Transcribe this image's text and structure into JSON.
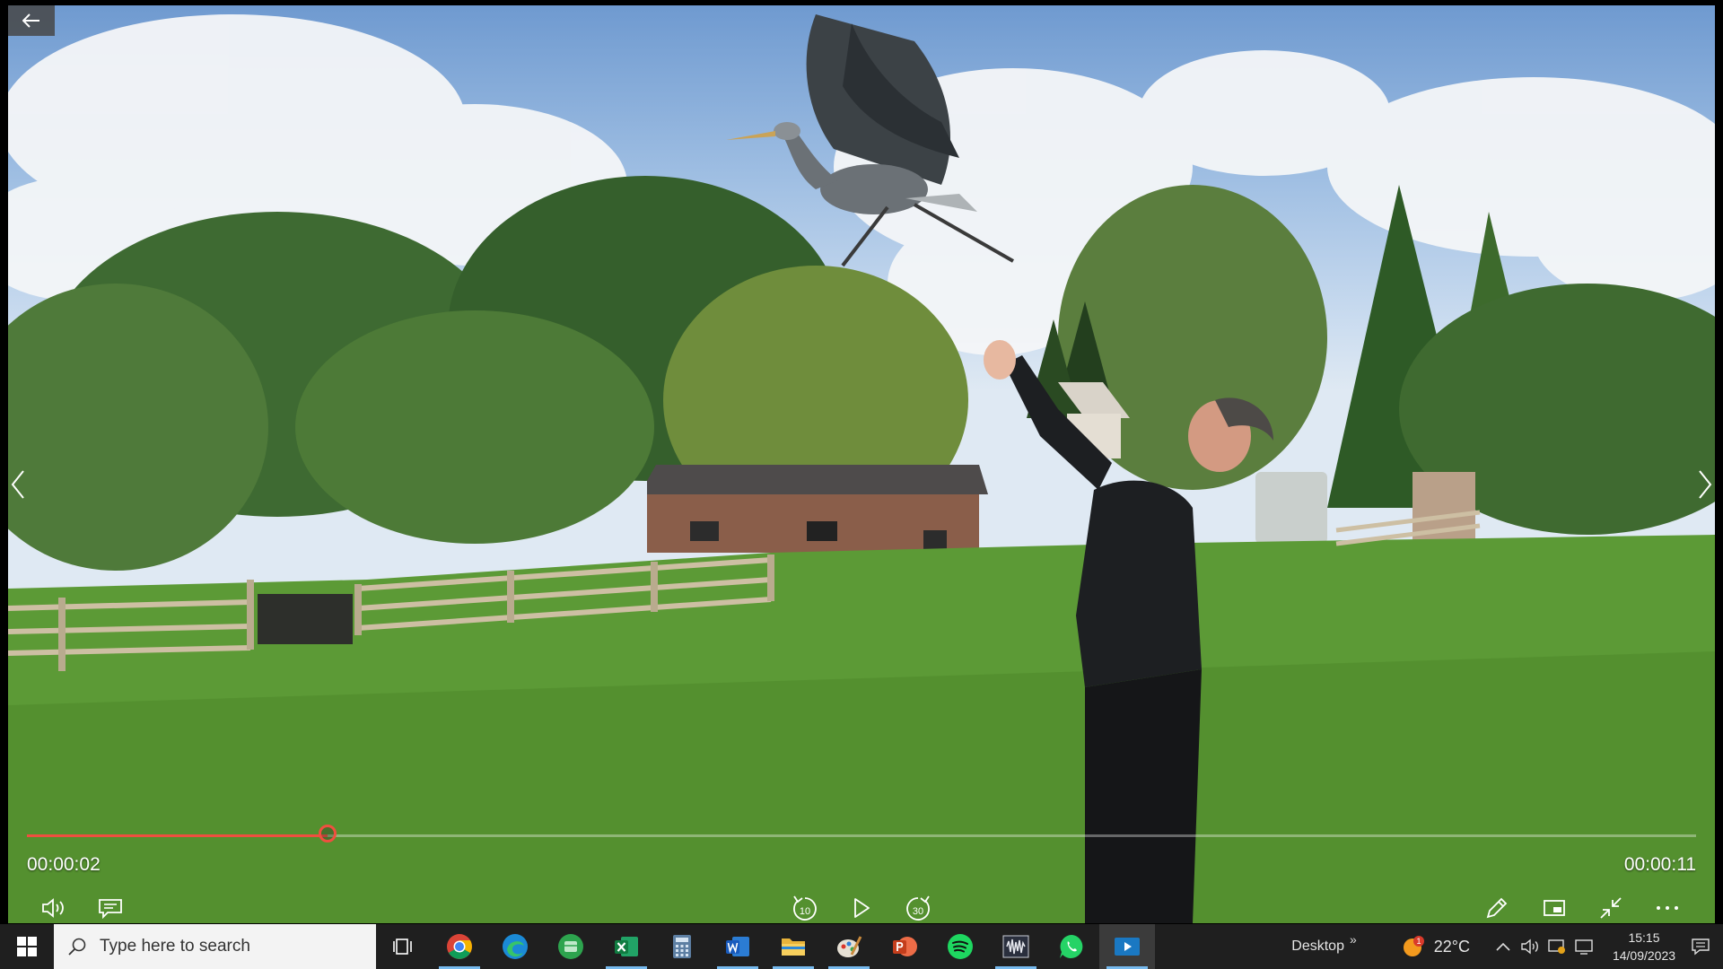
{
  "player": {
    "current_time": "00:00:02",
    "total_time": "00:00:11",
    "progress": 0.18,
    "accent_color": "#ef4f3f",
    "controls": {
      "volume": "volume-icon",
      "captions": "captions-icon",
      "skip_back_label": "10",
      "play": "play-icon",
      "skip_forward_label": "30",
      "edit": "pencil-icon",
      "mini_view": "mini-view-icon",
      "exit_fullscreen": "exit-fullscreen-icon",
      "more": "more-icon"
    }
  },
  "taskbar": {
    "search_placeholder": "Type here to search",
    "pinned_apps": [
      {
        "name": "task-view-icon",
        "running": false
      },
      {
        "name": "chrome-icon",
        "running": true
      },
      {
        "name": "edge-icon",
        "running": false
      },
      {
        "name": "green-app-icon",
        "running": false
      },
      {
        "name": "excel-icon",
        "running": true
      },
      {
        "name": "calculator-icon",
        "running": false
      },
      {
        "name": "word-icon",
        "running": true
      },
      {
        "name": "file-explorer-icon",
        "running": true
      },
      {
        "name": "paint-icon",
        "running": true
      },
      {
        "name": "powerpoint-icon",
        "running": false
      },
      {
        "name": "spotify-icon",
        "running": false
      },
      {
        "name": "audio-app-icon",
        "running": true
      },
      {
        "name": "whatsapp-icon",
        "running": false
      },
      {
        "name": "video-player-icon",
        "running": true,
        "active": true
      }
    ],
    "desktop_label": "Desktop",
    "desktop_chevron": "»",
    "weather_temp": "22°C",
    "time": "15:15",
    "date": "14/09/2023",
    "notification_badge": "1"
  }
}
